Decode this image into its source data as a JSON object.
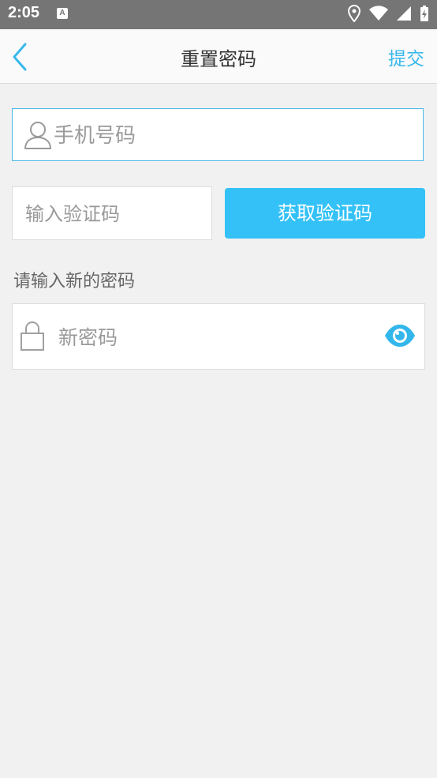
{
  "status_bar": {
    "time": "2:05",
    "notification_glyph": "A",
    "icons": [
      "location-icon",
      "wifi-icon",
      "signal-icon",
      "battery-charging-icon"
    ]
  },
  "app_bar": {
    "back_icon": "chevron-left-icon",
    "title": "重置密码",
    "submit_label": "提交"
  },
  "form": {
    "phone": {
      "placeholder": "手机号码",
      "value": "",
      "icon": "person-icon"
    },
    "code": {
      "placeholder": "输入验证码",
      "value": ""
    },
    "get_code_label": "获取验证码",
    "new_password_hint": "请输入新的密码",
    "password": {
      "placeholder": "新密码",
      "value": "",
      "icon": "lock-icon",
      "toggle_icon": "eye-icon"
    }
  },
  "colors": {
    "accent": "#33c1f7",
    "link": "#39b8ec",
    "status_bar": "#757575",
    "background": "#f1f1f2"
  }
}
